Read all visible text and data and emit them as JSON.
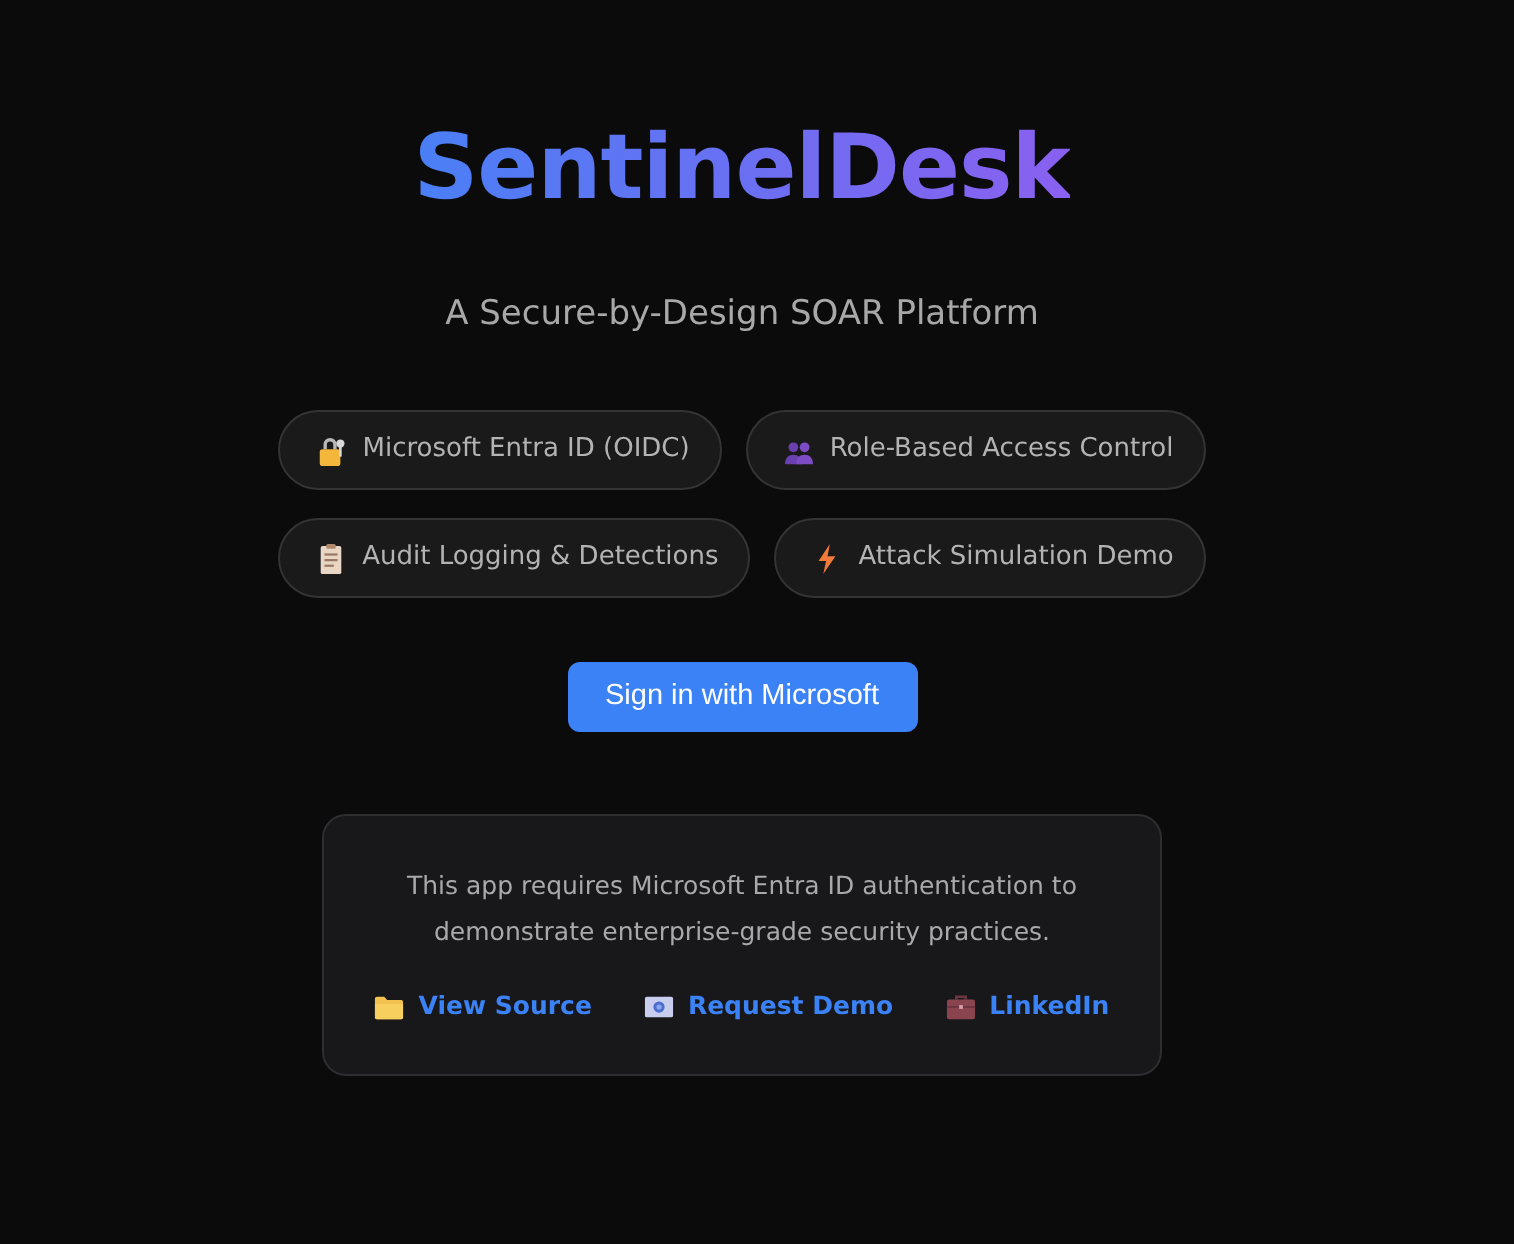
{
  "app": {
    "title": "SentinelDesk",
    "tagline": "A Secure-by-Design SOAR Platform"
  },
  "features": [
    "Microsoft Entra ID (OIDC)",
    "Role-Based Access Control",
    "Audit Logging & Detections",
    "Attack Simulation Demo"
  ],
  "sign_in_button": {
    "label": "Sign in with Microsoft"
  },
  "notice": {
    "text": "This app requires Microsoft Entra ID authentication to demonstrate enterprise-grade security practices.",
    "links": [
      "View Source",
      "Request Demo",
      "LinkedIn"
    ]
  }
}
